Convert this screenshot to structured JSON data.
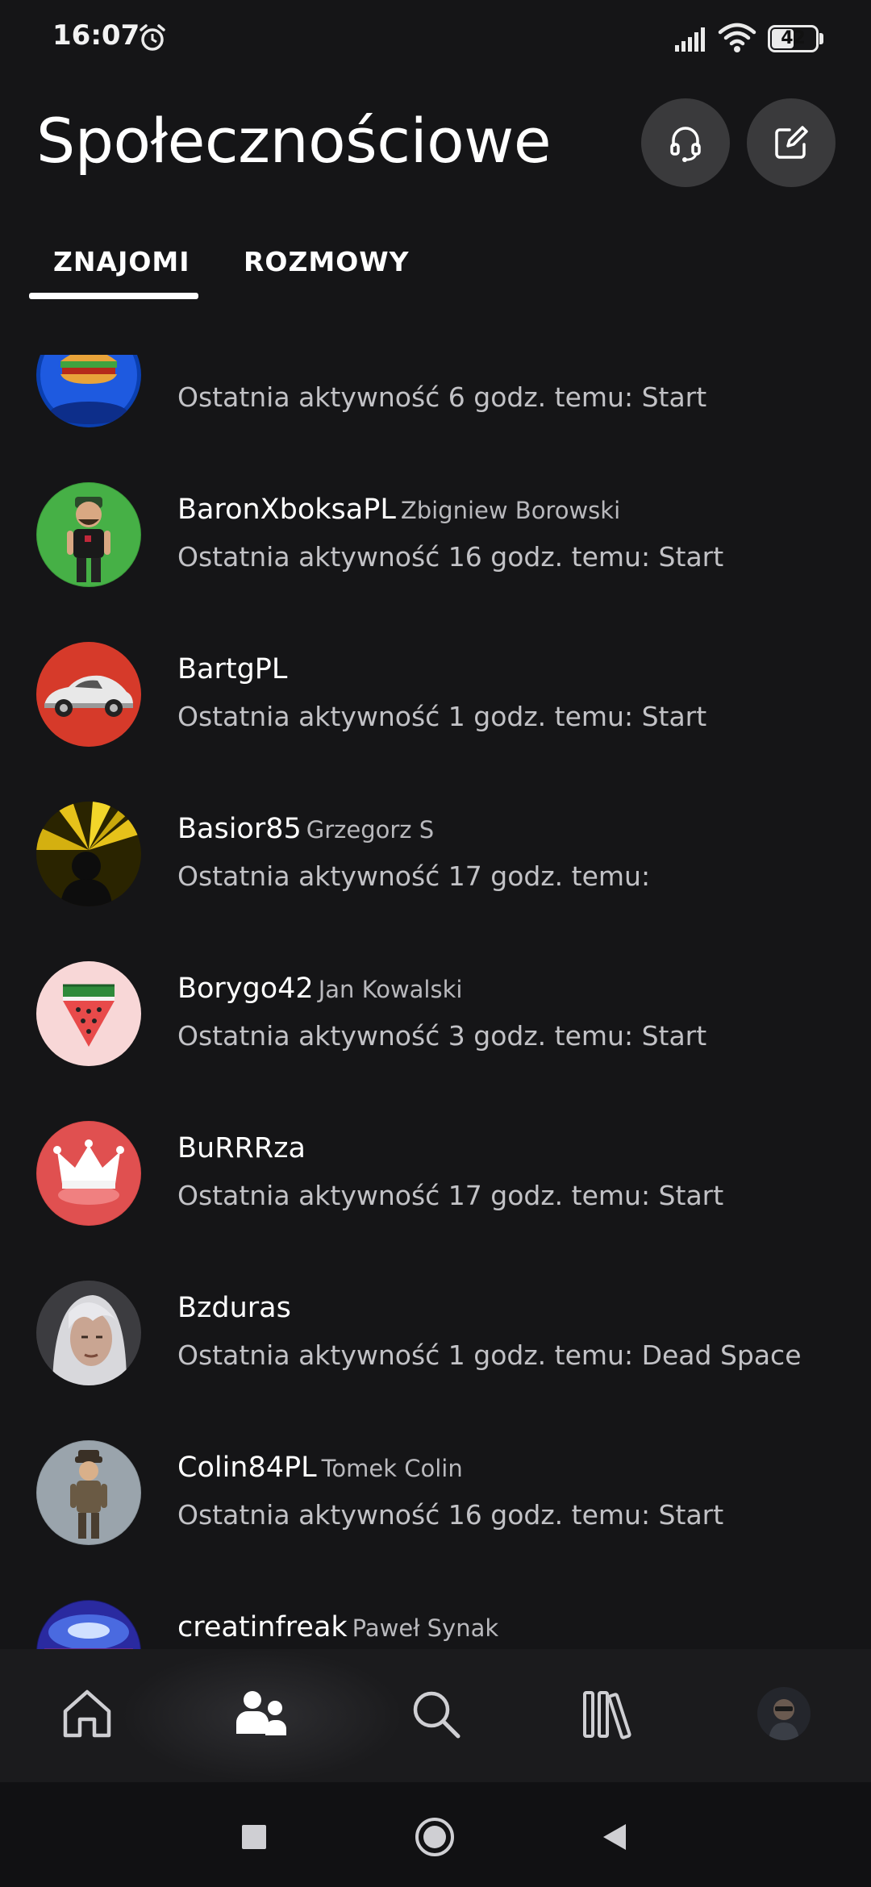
{
  "status_bar": {
    "time": "16:07",
    "battery": "42",
    "icons": [
      "alarm-icon",
      "signal-icon",
      "wifi-icon",
      "battery-icon"
    ]
  },
  "header": {
    "title": "Społecznościowe",
    "actions": [
      "headset-icon",
      "compose-icon"
    ]
  },
  "tabs": [
    {
      "label": "ZNAJOMI",
      "selected": true
    },
    {
      "label": "ROZMOWY",
      "selected": false
    }
  ],
  "friends": [
    {
      "gamertag": "",
      "real_name": "",
      "activity": "Ostatnia aktywność 6 godz. temu: Start"
    },
    {
      "gamertag": "BaronXboksaPL",
      "real_name": "Zbigniew Borowski",
      "activity": "Ostatnia aktywność 16 godz. temu: Start"
    },
    {
      "gamertag": "BartgPL",
      "real_name": "",
      "activity": "Ostatnia aktywność 1 godz. temu: Start"
    },
    {
      "gamertag": "Basior85",
      "real_name": "Grzegorz S",
      "activity": "Ostatnia aktywność 17 godz. temu:"
    },
    {
      "gamertag": "Borygo42",
      "real_name": "Jan Kowalski",
      "activity": "Ostatnia aktywność 3 godz. temu: Start"
    },
    {
      "gamertag": "BuRRRza",
      "real_name": "",
      "activity": "Ostatnia aktywność 17 godz. temu: Start"
    },
    {
      "gamertag": "Bzduras",
      "real_name": "",
      "activity": "Ostatnia aktywność 1 godz. temu: Dead Space"
    },
    {
      "gamertag": "Colin84PL",
      "real_name": "Tomek Colin",
      "activity": "Ostatnia aktywność 16 godz. temu: Start"
    },
    {
      "gamertag": "creatinfreak",
      "real_name": "Paweł Synak",
      "activity": ""
    }
  ],
  "bottom_nav": [
    {
      "icon": "home-icon",
      "selected": false
    },
    {
      "icon": "social-icon",
      "selected": true
    },
    {
      "icon": "search-icon",
      "selected": false
    },
    {
      "icon": "library-icon",
      "selected": false
    },
    {
      "icon": "profile-avatar",
      "selected": false
    }
  ],
  "colors": {
    "background": "#151517",
    "button": "#3a3a3c",
    "text_primary": "#ffffff",
    "text_secondary": "#c2c2c6"
  }
}
